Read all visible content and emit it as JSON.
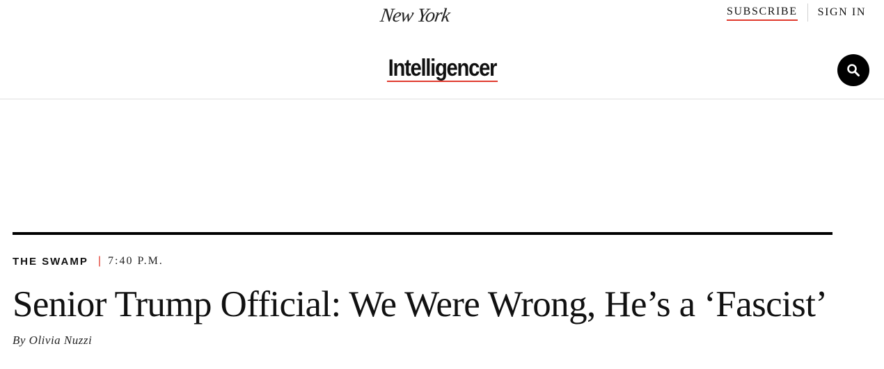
{
  "header": {
    "logo_text": "New York",
    "subscribe_label": "SUBSCRIBE",
    "signin_label": "SIGN IN",
    "section_title": "Intelligencer",
    "search_icon": "search-icon"
  },
  "article": {
    "rubric": "THE SWAMP",
    "separator": "|",
    "time": "7:40 P.M.",
    "headline": "Senior Trump Official: We Were Wrong, He’s a ‘Fascist’",
    "byline": "By Olivia Nuzzi"
  },
  "colors": {
    "accent": "#e0392d",
    "text": "#111111",
    "background": "#ffffff"
  }
}
